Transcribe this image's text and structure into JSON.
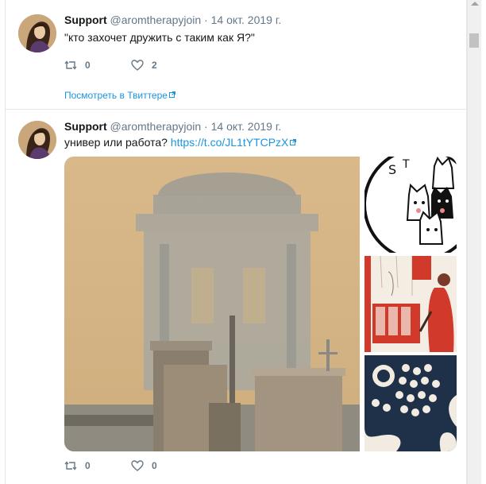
{
  "tweets": [
    {
      "name": "Support",
      "handle": "@aromtherapyjoin",
      "separator": "·",
      "date": "14 окт. 2019 г.",
      "text": "\"кто захочет дружить с таким как Я?\"",
      "retweets": "0",
      "likes": "2",
      "view_link": "Посмотреть в Твиттере"
    },
    {
      "name": "Support",
      "handle": "@aromtherapyjoin",
      "separator": "·",
      "date": "14 окт. 2019 г.",
      "text": "универ или работа?",
      "link": "https://t.co/JL1tYTCPzX",
      "retweets": "0",
      "likes": "0"
    }
  ],
  "icons": {
    "retweet": "retweet-icon",
    "like": "heart-icon",
    "external": "external-link-icon"
  },
  "colors": {
    "link": "#1b95e0",
    "muted": "#657786",
    "text": "#14171a",
    "border": "#e1e8ed"
  }
}
